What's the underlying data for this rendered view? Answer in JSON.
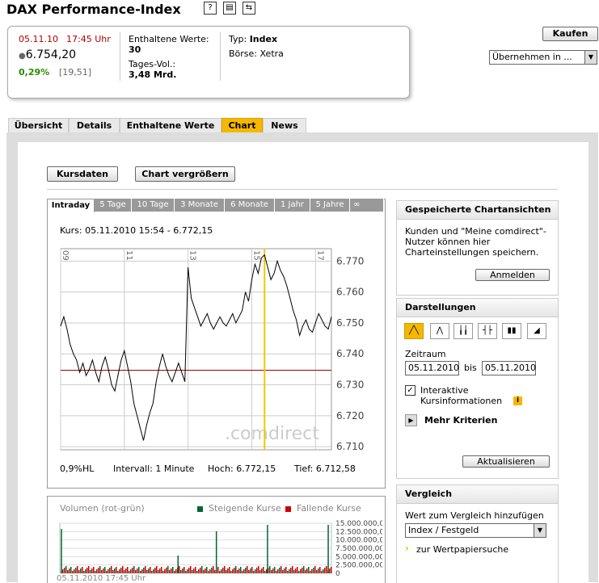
{
  "header": {
    "title": "DAX Performance-Index",
    "icons": [
      "help-icon",
      "print-icon",
      "share-icon"
    ]
  },
  "quote": {
    "date": "05.11.10",
    "time": "17:45 Uhr",
    "price": "6.754,20",
    "change_pct": "0,29%",
    "change_abs": "[19,51]",
    "contained_label": "Enthaltene Werte:",
    "contained_value": "30",
    "volume_label": "Tages-Vol.:",
    "volume_value": "3,48 Mrd.",
    "type_label": "Typ:",
    "type_value": "Index",
    "exchange_label": "Börse:",
    "exchange_value": "Xetra"
  },
  "actions": {
    "buy_label": "Kaufen",
    "adopt_select": "Übernehmen in ..."
  },
  "tabs": [
    "Übersicht",
    "Details",
    "Enthaltene Werte",
    "Chart",
    "News"
  ],
  "chart_buttons": {
    "kursdaten": "Kursdaten",
    "enlarge": "Chart vergrößern"
  },
  "range_tabs": [
    "Intraday",
    "5 Tage",
    "10 Tage",
    "3 Monate",
    "6 Monate",
    "1 Jahr",
    "5 Jahre",
    "∞"
  ],
  "chart_info": {
    "kurs": "Kurs: 05.11.2010 15:54 - 6.772,15",
    "hl": "0,9%HL",
    "interval": "Intervall: 1 Minute",
    "high": "Hoch:  6.772,15",
    "low": "Tief:  6.712,58",
    "watermark": ".comdirect"
  },
  "volume_info": {
    "title": "Volumen (rot-grün)",
    "rising": "Steigende Kurse",
    "falling": "Fallende Kurse",
    "timestamp": "05.11.2010 17:45 Uhr"
  },
  "saved_views": {
    "title": "Gespeicherte Chartansichten",
    "text": "Kunden und \"Meine comdirect\"-Nutzer können hier Charteinstellungen speichern.",
    "login": "Anmelden"
  },
  "display": {
    "title": "Darstellungen",
    "icons": [
      "line-chart-icon",
      "mountain-chart-icon",
      "ohlc-chart-icon",
      "bar-chart-icon",
      "candlestick-chart-icon",
      "area-chart-icon"
    ],
    "period_label": "Zeitraum",
    "from": "05.11.2010",
    "to_label": "bis",
    "to": "05.11.2010",
    "interactive_label": "Interaktive Kursinformationen",
    "more_criteria": "Mehr Kriterien",
    "refresh": "Aktualisieren"
  },
  "compare": {
    "title": "Vergleich",
    "label": "Wert zum Vergleich hinzufügen",
    "select": "Index / Festgeld",
    "link": "zur Wertpapiersuche"
  },
  "colors": {
    "accent": "#f5b800",
    "positive": "#2a8a00",
    "negative": "#b00000",
    "rising": "#006633",
    "falling": "#cc0000"
  },
  "chart_data": {
    "type": "line",
    "x_ticks": [
      "09",
      "11",
      "13",
      "15",
      "17"
    ],
    "y_ticks": [
      "6.770",
      "6.760",
      "6.750",
      "6.740",
      "6.730",
      "6.720",
      "6.710"
    ],
    "ylim": [
      6709,
      6774
    ],
    "reference_line": 6734.7,
    "x": [
      9.0,
      9.1,
      9.2,
      9.3,
      9.4,
      9.5,
      9.6,
      9.7,
      9.8,
      9.9,
      10.0,
      10.1,
      10.2,
      10.3,
      10.4,
      10.5,
      10.6,
      10.7,
      10.8,
      10.9,
      11.0,
      11.1,
      11.2,
      11.3,
      11.4,
      11.5,
      11.6,
      11.7,
      11.8,
      11.9,
      12.0,
      12.1,
      12.2,
      12.3,
      12.4,
      12.5,
      12.6,
      12.7,
      12.8,
      12.9,
      13.0,
      13.1,
      13.2,
      13.3,
      13.4,
      13.5,
      13.6,
      13.7,
      13.8,
      13.9,
      14.0,
      14.1,
      14.2,
      14.3,
      14.4,
      14.5,
      14.6,
      14.7,
      14.8,
      14.9,
      15.0,
      15.1,
      15.2,
      15.3,
      15.4,
      15.5,
      15.6,
      15.7,
      15.8,
      15.9,
      16.0,
      16.1,
      16.2,
      16.3,
      16.4,
      16.5,
      16.6,
      16.7,
      16.8,
      16.9,
      17.0,
      17.1,
      17.2,
      17.3,
      17.4,
      17.5
    ],
    "values": [
      6749,
      6752,
      6748,
      6743,
      6740,
      6738,
      6734,
      6737,
      6733,
      6735,
      6738,
      6734,
      6731,
      6736,
      6739,
      6735,
      6730,
      6728,
      6733,
      6738,
      6741,
      6736,
      6731,
      6724,
      6720,
      6716,
      6712,
      6717,
      6721,
      6724,
      6731,
      6736,
      6740,
      6736,
      6733,
      6731,
      6734,
      6737,
      6734,
      6731,
      6768,
      6758,
      6755,
      6752,
      6749,
      6751,
      6753,
      6750,
      6748,
      6750,
      6752,
      6750,
      6749,
      6751,
      6753,
      6750,
      6752,
      6754,
      6760,
      6757,
      6764,
      6769,
      6766,
      6771,
      6772,
      6768,
      6764,
      6766,
      6770,
      6767,
      6765,
      6762,
      6758,
      6754,
      6751,
      6746,
      6749,
      6751,
      6748,
      6747,
      6750,
      6753,
      6751,
      6749,
      6748,
      6752,
      6754,
      6750,
      6748,
      6753
    ],
    "marker_x": 15.4,
    "volume_ticks": [
      "15.000.000,00",
      "12.500.000,00",
      "10.000.000,00",
      "7.500.000,00",
      "5.000.000,00",
      "2.500.000,00",
      "0"
    ]
  }
}
